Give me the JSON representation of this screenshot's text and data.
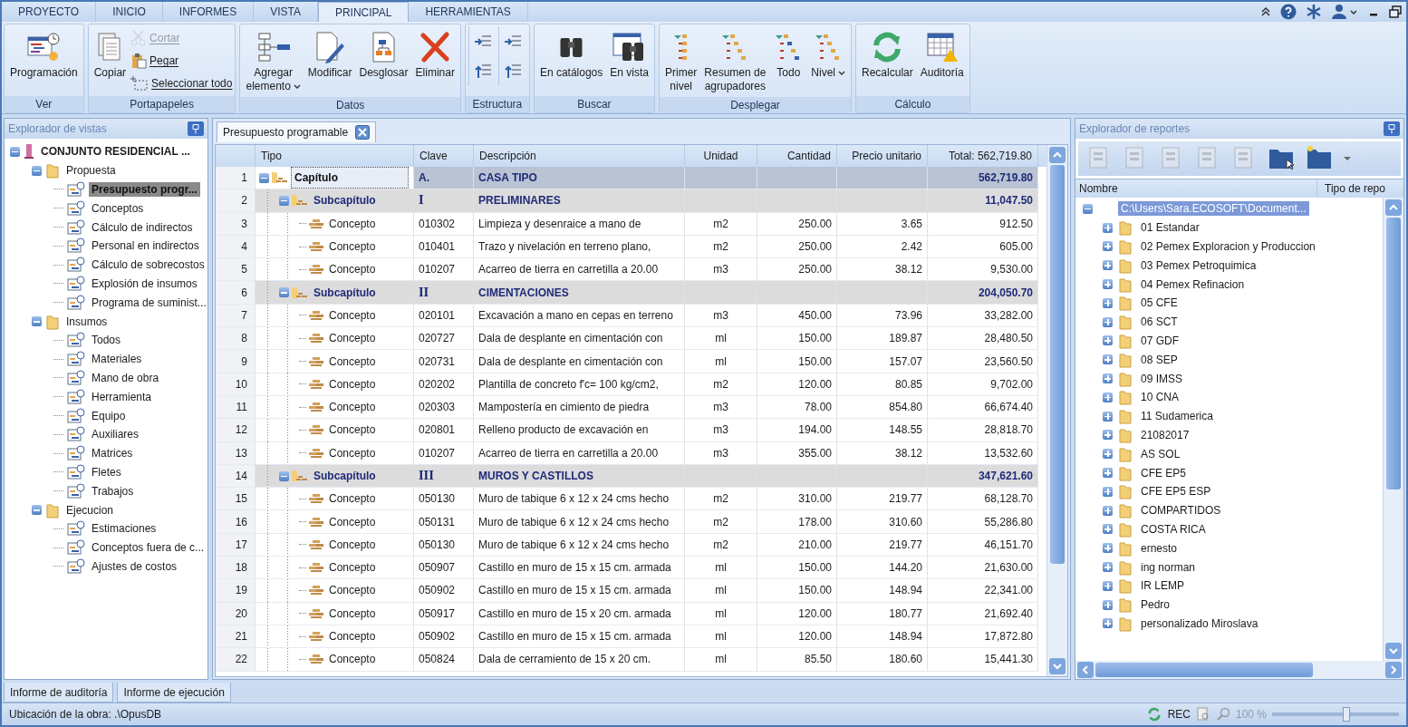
{
  "ribbon": {
    "tabs": [
      {
        "label": "PROYECTO",
        "selected": false
      },
      {
        "label": "INICIO",
        "selected": false
      },
      {
        "label": "INFORMES",
        "selected": false
      },
      {
        "label": "VISTA",
        "selected": false
      },
      {
        "label": "PRINCIPAL",
        "selected": true
      },
      {
        "label": "HERRAMIENTAS",
        "selected": false
      }
    ],
    "groups": [
      {
        "label": "Ver",
        "buttons": [
          {
            "label": "Programación",
            "kind": "large",
            "disabled": false
          }
        ]
      },
      {
        "label": "Portapapeles",
        "buttons": [
          {
            "label": "Copiar",
            "kind": "large",
            "disabled": false
          },
          {
            "label": "Cortar",
            "kind": "small",
            "disabled": true
          },
          {
            "label": "Pegar",
            "kind": "small",
            "disabled": false
          },
          {
            "label": "Seleccionar todo",
            "kind": "small",
            "disabled": false
          }
        ]
      },
      {
        "label": "Datos",
        "buttons": [
          {
            "label": "Agregar\nelemento",
            "kind": "split",
            "disabled": false
          },
          {
            "label": "Modificar",
            "kind": "large",
            "disabled": false
          },
          {
            "label": "Desglosar",
            "kind": "large",
            "disabled": false
          },
          {
            "label": "Eliminar",
            "kind": "large",
            "disabled": false
          }
        ]
      },
      {
        "label": "Estructura",
        "buttons": [
          {
            "kind": "icon",
            "disabled": false
          },
          {
            "kind": "icon",
            "disabled": false
          },
          {
            "kind": "icon",
            "disabled": false
          },
          {
            "kind": "icon",
            "disabled": false
          }
        ]
      },
      {
        "label": "Buscar",
        "buttons": [
          {
            "label": "En catálogos",
            "kind": "large",
            "disabled": false
          },
          {
            "label": "En vista",
            "kind": "large",
            "disabled": false
          }
        ]
      },
      {
        "label": "Desplegar",
        "buttons": [
          {
            "label": "Primer\nnivel",
            "kind": "large",
            "disabled": false
          },
          {
            "label": "Resumen de\nagrupadores",
            "kind": "large",
            "disabled": false
          },
          {
            "label": "Todo",
            "kind": "large",
            "disabled": false
          },
          {
            "label": "Nivel",
            "kind": "split",
            "disabled": false
          }
        ]
      },
      {
        "label": "Cálculo",
        "buttons": [
          {
            "label": "Recalcular",
            "kind": "large",
            "disabled": false
          },
          {
            "label": "Auditoría",
            "kind": "large",
            "disabled": false
          }
        ]
      }
    ]
  },
  "views_explorer": {
    "title": "Explorador de vistas",
    "tree": [
      {
        "label": "CONJUNTO RESIDENCIAL ...",
        "kind": "root",
        "expanded": true,
        "selected": false,
        "children": [
          {
            "label": "Propuesta",
            "kind": "group",
            "expanded": true,
            "selected": false,
            "children": [
              {
                "label": "Presupuesto progr...",
                "kind": "leaf",
                "selected": true
              },
              {
                "label": "Conceptos",
                "kind": "leaf",
                "selected": false
              },
              {
                "label": "Cálculo de indirectos",
                "kind": "leaf",
                "selected": false
              },
              {
                "label": "Personal en indirectos",
                "kind": "leaf",
                "selected": false
              },
              {
                "label": "Cálculo de sobrecostos",
                "kind": "leaf",
                "selected": false
              },
              {
                "label": "Explosión de insumos",
                "kind": "leaf",
                "selected": false
              },
              {
                "label": "Programa de suminist...",
                "kind": "leaf",
                "selected": false
              }
            ]
          },
          {
            "label": "Insumos",
            "kind": "group",
            "expanded": true,
            "selected": false,
            "children": [
              {
                "label": "Todos",
                "kind": "leaf",
                "selected": false
              },
              {
                "label": "Materiales",
                "kind": "leaf",
                "selected": false
              },
              {
                "label": "Mano de obra",
                "kind": "leaf",
                "selected": false
              },
              {
                "label": "Herramienta",
                "kind": "leaf",
                "selected": false
              },
              {
                "label": "Equipo",
                "kind": "leaf",
                "selected": false
              },
              {
                "label": "Auxiliares",
                "kind": "leaf",
                "selected": false
              },
              {
                "label": "Matrices",
                "kind": "leaf",
                "selected": false
              },
              {
                "label": "Fletes",
                "kind": "leaf",
                "selected": false
              },
              {
                "label": "Trabajos",
                "kind": "leaf",
                "selected": false
              }
            ]
          },
          {
            "label": "Ejecucion",
            "kind": "group",
            "expanded": true,
            "selected": false,
            "children": [
              {
                "label": "Estimaciones",
                "kind": "leaf",
                "selected": false
              },
              {
                "label": "Conceptos fuera de c...",
                "kind": "leaf",
                "selected": false
              },
              {
                "label": "Ajustes de costos",
                "kind": "leaf",
                "selected": false
              }
            ]
          }
        ]
      }
    ]
  },
  "document": {
    "tab": "Presupuesto programable",
    "table": {
      "columns": [
        "Tipo",
        "Clave",
        "Descripción",
        "Unidad",
        "Cantidad",
        "Precio unitario",
        "Total: 562,719.80"
      ],
      "rows": [
        {
          "n": "1",
          "kind": "capitulo",
          "tipo": "Capítulo",
          "clave": "A.",
          "descripcion": "CASA TIPO",
          "total": "562,719.80",
          "expanded": true,
          "selected": true,
          "children": [
            {
              "n": "2",
              "kind": "subcapitulo",
              "tipo": "Subcapítulo",
              "clave": "I",
              "descripcion": "PRELIMINARES",
              "total": "11,047.50",
              "expanded": true,
              "selected": false,
              "children": [
                {
                  "n": "3",
                  "kind": "concepto",
                  "tipo": "Concepto",
                  "clave": "010302",
                  "descripcion": "Limpieza y desenraice a mano de",
                  "unidad": "m2",
                  "cantidad": "250.00",
                  "precio": "3.65",
                  "total": "912.50",
                  "selected": false
                },
                {
                  "n": "4",
                  "kind": "concepto",
                  "tipo": "Concepto",
                  "clave": "010401",
                  "descripcion": "Trazo y nivelación en terreno plano,",
                  "unidad": "m2",
                  "cantidad": "250.00",
                  "precio": "2.42",
                  "total": "605.00",
                  "selected": false
                },
                {
                  "n": "5",
                  "kind": "concepto",
                  "tipo": "Concepto",
                  "clave": "010207",
                  "descripcion": "Acarreo de tierra en carretilla a 20.00",
                  "unidad": "m3",
                  "cantidad": "250.00",
                  "precio": "38.12",
                  "total": "9,530.00",
                  "selected": false
                }
              ]
            },
            {
              "n": "6",
              "kind": "subcapitulo",
              "tipo": "Subcapítulo",
              "clave": "II",
              "descripcion": "CIMENTACIONES",
              "total": "204,050.70",
              "expanded": true,
              "selected": false,
              "children": [
                {
                  "n": "7",
                  "kind": "concepto",
                  "tipo": "Concepto",
                  "clave": "020101",
                  "descripcion": "Excavación a mano en cepas en terreno",
                  "unidad": "m3",
                  "cantidad": "450.00",
                  "precio": "73.96",
                  "total": "33,282.00",
                  "selected": false
                },
                {
                  "n": "8",
                  "kind": "concepto",
                  "tipo": "Concepto",
                  "clave": "020727",
                  "descripcion": "Dala de desplante en cimentación con",
                  "unidad": "ml",
                  "cantidad": "150.00",
                  "precio": "189.87",
                  "total": "28,480.50",
                  "selected": false
                },
                {
                  "n": "9",
                  "kind": "concepto",
                  "tipo": "Concepto",
                  "clave": "020731",
                  "descripcion": "Dala de desplante en cimentación con",
                  "unidad": "ml",
                  "cantidad": "150.00",
                  "precio": "157.07",
                  "total": "23,560.50",
                  "selected": false
                },
                {
                  "n": "10",
                  "kind": "concepto",
                  "tipo": "Concepto",
                  "clave": "020202",
                  "descripcion": "Plantilla de concreto f'c= 100 kg/cm2,",
                  "unidad": "m2",
                  "cantidad": "120.00",
                  "precio": "80.85",
                  "total": "9,702.00",
                  "selected": false
                },
                {
                  "n": "11",
                  "kind": "concepto",
                  "tipo": "Concepto",
                  "clave": "020303",
                  "descripcion": "Mampostería en cimiento de piedra",
                  "unidad": "m3",
                  "cantidad": "78.00",
                  "precio": "854.80",
                  "total": "66,674.40",
                  "selected": false
                },
                {
                  "n": "12",
                  "kind": "concepto",
                  "tipo": "Concepto",
                  "clave": "020801",
                  "descripcion": "Relleno producto de excavación en",
                  "unidad": "m3",
                  "cantidad": "194.00",
                  "precio": "148.55",
                  "total": "28,818.70",
                  "selected": false
                },
                {
                  "n": "13",
                  "kind": "concepto",
                  "tipo": "Concepto",
                  "clave": "010207",
                  "descripcion": "Acarreo de tierra en carretilla a 20.00",
                  "unidad": "m3",
                  "cantidad": "355.00",
                  "precio": "38.12",
                  "total": "13,532.60",
                  "selected": false
                }
              ]
            },
            {
              "n": "14",
              "kind": "subcapitulo",
              "tipo": "Subcapítulo",
              "clave": "III",
              "descripcion": "MUROS Y CASTILLOS",
              "total": "347,621.60",
              "expanded": true,
              "selected": false,
              "children": [
                {
                  "n": "15",
                  "kind": "concepto",
                  "tipo": "Concepto",
                  "clave": "050130",
                  "descripcion": "Muro de tabique 6 x 12 x 24 cms hecho",
                  "unidad": "m2",
                  "cantidad": "310.00",
                  "precio": "219.77",
                  "total": "68,128.70",
                  "selected": false
                },
                {
                  "n": "16",
                  "kind": "concepto",
                  "tipo": "Concepto",
                  "clave": "050131",
                  "descripcion": "Muro de tabique 6 x 12 x 24 cms hecho",
                  "unidad": "m2",
                  "cantidad": "178.00",
                  "precio": "310.60",
                  "total": "55,286.80",
                  "selected": false
                },
                {
                  "n": "17",
                  "kind": "concepto",
                  "tipo": "Concepto",
                  "clave": "050130",
                  "descripcion": "Muro de tabique 6 x 12 x 24 cms hecho",
                  "unidad": "m2",
                  "cantidad": "210.00",
                  "precio": "219.77",
                  "total": "46,151.70",
                  "selected": false
                },
                {
                  "n": "18",
                  "kind": "concepto",
                  "tipo": "Concepto",
                  "clave": "050907",
                  "descripcion": "Castillo en muro de 15 x 15 cm. armada",
                  "unidad": "ml",
                  "cantidad": "150.00",
                  "precio": "144.20",
                  "total": "21,630.00",
                  "selected": false
                },
                {
                  "n": "19",
                  "kind": "concepto",
                  "tipo": "Concepto",
                  "clave": "050902",
                  "descripcion": "Castillo en muro de 15 x 15 cm. armada",
                  "unidad": "ml",
                  "cantidad": "150.00",
                  "precio": "148.94",
                  "total": "22,341.00",
                  "selected": false
                },
                {
                  "n": "20",
                  "kind": "concepto",
                  "tipo": "Concepto",
                  "clave": "050917",
                  "descripcion": "Castillo en muro de 15 x 20 cm. armada",
                  "unidad": "ml",
                  "cantidad": "120.00",
                  "precio": "180.77",
                  "total": "21,692.40",
                  "selected": false
                },
                {
                  "n": "21",
                  "kind": "concepto",
                  "tipo": "Concepto",
                  "clave": "050902",
                  "descripcion": "Castillo en muro de 15 x 15 cm. armada",
                  "unidad": "ml",
                  "cantidad": "120.00",
                  "precio": "148.94",
                  "total": "17,872.80",
                  "selected": false
                },
                {
                  "n": "22",
                  "kind": "concepto",
                  "tipo": "Concepto",
                  "clave": "050824",
                  "descripcion": "Dala de cerramiento de 15 x 20 cm.",
                  "unidad": "ml",
                  "cantidad": "85.50",
                  "precio": "180.60",
                  "total": "15,441.30",
                  "selected": false
                }
              ]
            }
          ]
        }
      ]
    }
  },
  "reports_explorer": {
    "title": "Explorador de reportes",
    "toolbar": [
      {
        "disabled": true
      },
      {
        "disabled": true
      },
      {
        "disabled": true
      },
      {
        "disabled": true
      },
      {
        "disabled": true
      },
      {
        "disabled": false
      },
      {
        "disabled": false
      }
    ],
    "columns": [
      "Nombre",
      "Tipo de repo"
    ],
    "tree": [
      {
        "label": "C:\\Users\\Sara.ECOSOFT\\Document...",
        "expanded": true,
        "selected": true,
        "children": [
          {
            "label": "01 Estandar",
            "expanded": false,
            "selected": false
          },
          {
            "label": "02 Pemex Exploracion y Produccion",
            "expanded": false,
            "selected": false
          },
          {
            "label": "03 Pemex Petroquimica",
            "expanded": false,
            "selected": false
          },
          {
            "label": "04 Pemex Refinacion",
            "expanded": false,
            "selected": false
          },
          {
            "label": "05 CFE",
            "expanded": false,
            "selected": false
          },
          {
            "label": "06 SCT",
            "expanded": false,
            "selected": false
          },
          {
            "label": "07 GDF",
            "expanded": false,
            "selected": false
          },
          {
            "label": "08 SEP",
            "expanded": false,
            "selected": false
          },
          {
            "label": "09 IMSS",
            "expanded": false,
            "selected": false
          },
          {
            "label": "10 CNA",
            "expanded": false,
            "selected": false
          },
          {
            "label": "11 Sudamerica",
            "expanded": false,
            "selected": false
          },
          {
            "label": "21082017",
            "expanded": false,
            "selected": false
          },
          {
            "label": "AS SOL",
            "expanded": false,
            "selected": false
          },
          {
            "label": "CFE EP5",
            "expanded": false,
            "selected": false
          },
          {
            "label": "CFE EP5 ESP",
            "expanded": false,
            "selected": false
          },
          {
            "label": "COMPARTIDOS",
            "expanded": false,
            "selected": false
          },
          {
            "label": "COSTA RICA",
            "expanded": false,
            "selected": false
          },
          {
            "label": "ernesto",
            "expanded": false,
            "selected": false
          },
          {
            "label": "ing norman",
            "expanded": false,
            "selected": false
          },
          {
            "label": "IR LEMP",
            "expanded": false,
            "selected": false
          },
          {
            "label": "Pedro",
            "expanded": false,
            "selected": false
          },
          {
            "label": "personalizado Miroslava",
            "expanded": false,
            "selected": false
          }
        ]
      }
    ]
  },
  "bottom_tabs": [
    "Informe de auditoría",
    "Informe de ejecución"
  ],
  "status_bar": {
    "location": "Ubicación de la obra: .\\OpusDB",
    "rec": "REC",
    "zoom": "100 %",
    "zoom_slider": {
      "level": 0.58
    }
  }
}
